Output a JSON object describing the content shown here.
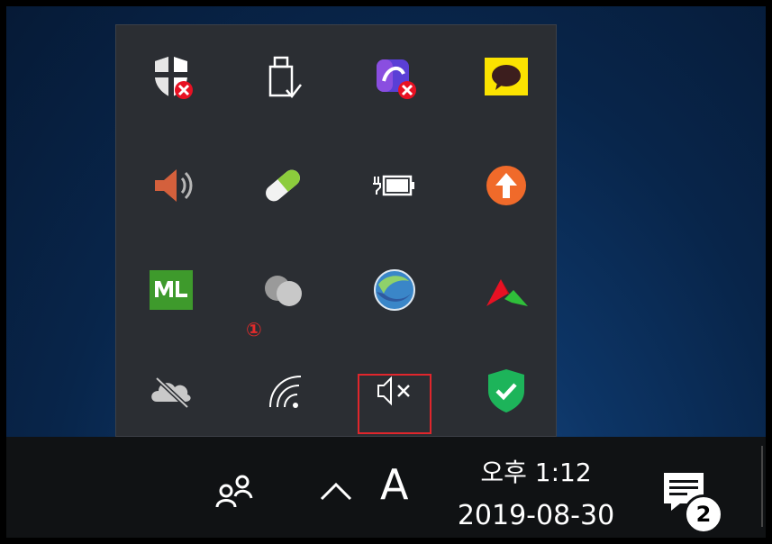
{
  "tray": {
    "rows": [
      [
        "windows-security-warning",
        "usb-safely-remove",
        "app-blocked",
        "kakaotalk"
      ],
      [
        "volume-speaker",
        "pill-app",
        "battery-charging",
        "update-arrow"
      ],
      [
        "ml-app",
        "chat-bubbles",
        "network-globe",
        "red-green-arrow-app"
      ],
      [
        "cloud-offline",
        "wifi",
        "speaker-muted",
        "shield-check"
      ]
    ],
    "highlight_marker": "①"
  },
  "taskbar": {
    "ime_label": "A",
    "time": "오후 1:12",
    "date": "2019-08-30",
    "notification_count": "2"
  },
  "colors": {
    "flyout_bg": "#2b2e33",
    "highlight": "#e0262c",
    "taskbar_bg": "#101214"
  }
}
